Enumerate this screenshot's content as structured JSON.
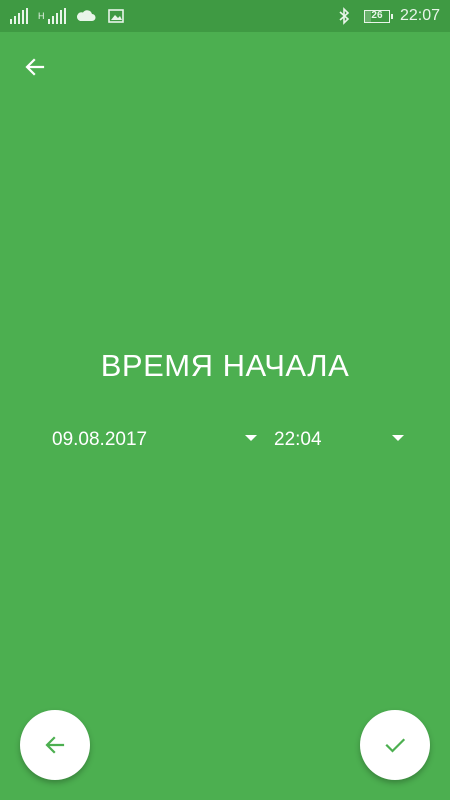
{
  "status_bar": {
    "network_type": "H",
    "battery_level": "26",
    "time": "22:07",
    "icons": [
      "signal-icon",
      "signal-icon",
      "cloud-icon",
      "image-icon",
      "bluetooth-icon",
      "battery-icon"
    ]
  },
  "screen": {
    "title": "ВРЕМЯ НАЧАЛА",
    "date_value": "09.08.2017",
    "time_value": "22:04"
  },
  "colors": {
    "background": "#4caf50",
    "status_bar": "#3f9a43",
    "fab_background": "#ffffff",
    "fab_icon": "#4caf50"
  }
}
